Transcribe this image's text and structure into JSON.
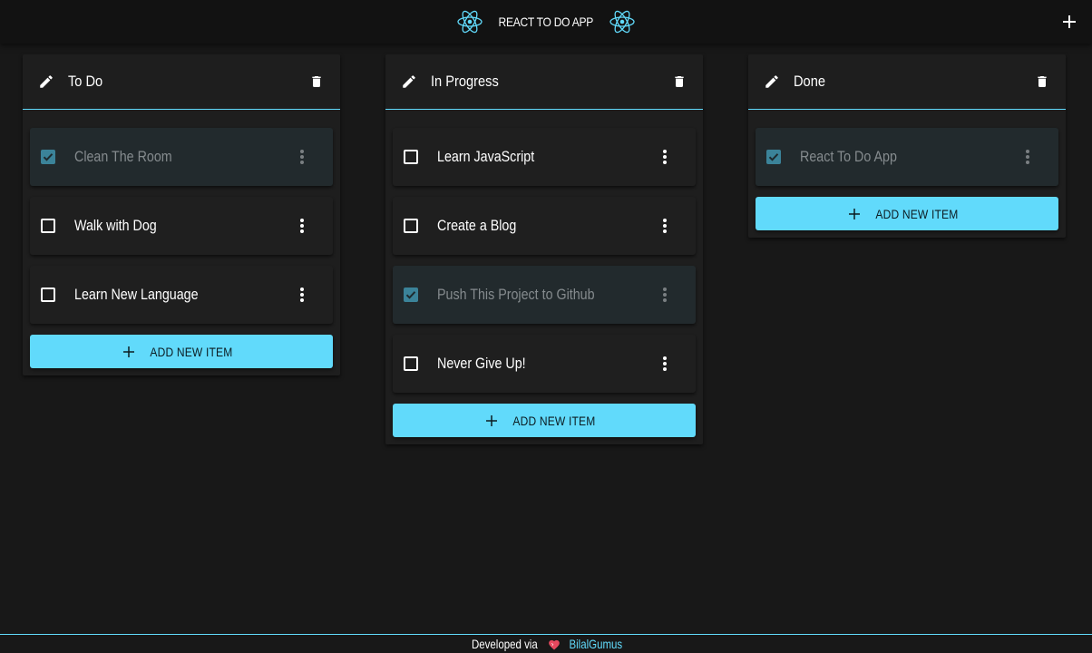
{
  "app": {
    "title": "REACT TO DO APP",
    "accent_color": "#61dafb",
    "add_list_icon": "plus-icon"
  },
  "columns": [
    {
      "title": "To Do",
      "edit_icon": "pencil-icon",
      "delete_icon": "trash-icon",
      "items": [
        {
          "text": "Clean The Room",
          "checked": true
        },
        {
          "text": "Walk with Dog",
          "checked": false
        },
        {
          "text": "Learn New Language",
          "checked": false
        }
      ],
      "add_label": "ADD NEW ITEM"
    },
    {
      "title": "In Progress",
      "edit_icon": "pencil-icon",
      "delete_icon": "trash-icon",
      "items": [
        {
          "text": "Learn JavaScript",
          "checked": false
        },
        {
          "text": "Create a Blog",
          "checked": false
        },
        {
          "text": "Push This Project to Github",
          "checked": true
        },
        {
          "text": "Never Give Up!",
          "checked": false
        }
      ],
      "add_label": "ADD NEW ITEM"
    },
    {
      "title": "Done",
      "edit_icon": "pencil-icon",
      "delete_icon": "trash-icon",
      "items": [
        {
          "text": "React To Do App",
          "checked": true
        }
      ],
      "add_label": "ADD NEW ITEM"
    }
  ],
  "footer": {
    "text": "Developed via",
    "heart_icon": "heart-icon",
    "author": "BilalGumus"
  }
}
